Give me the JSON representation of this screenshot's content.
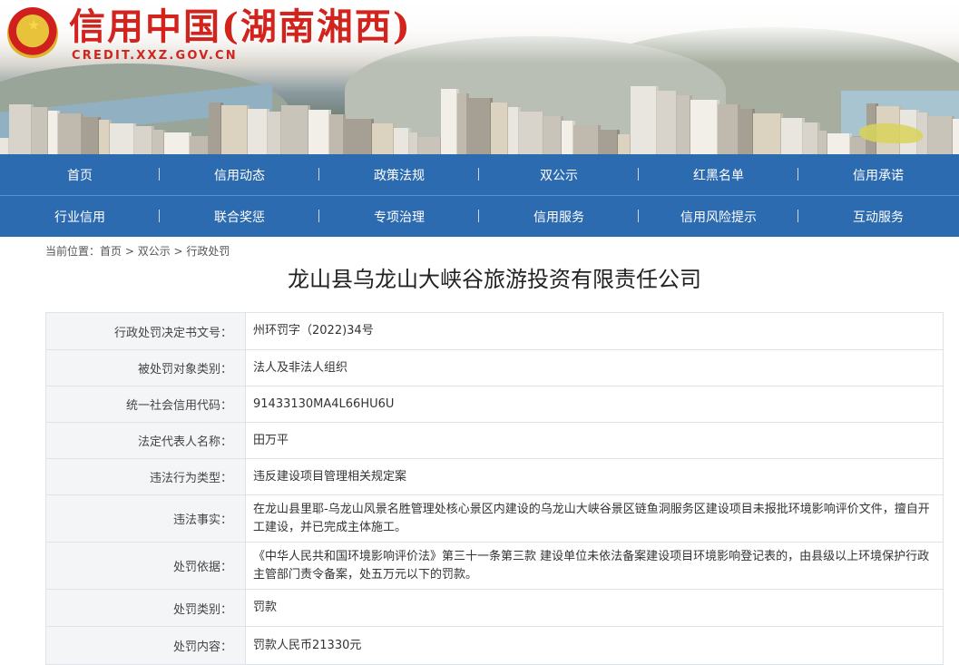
{
  "header": {
    "site_title": "信用中国(湖南湘西)",
    "site_url": "CREDIT.XXZ.GOV.CN"
  },
  "nav": {
    "row1": [
      "首页",
      "信用动态",
      "政策法规",
      "双公示",
      "红黑名单",
      "信用承诺"
    ],
    "row2": [
      "行业信用",
      "联合奖惩",
      "专项治理",
      "信用服务",
      "信用风险提示",
      "互动服务"
    ]
  },
  "breadcrumb": {
    "prefix": "当前位置：",
    "items": [
      "首页",
      "双公示",
      "行政处罚"
    ],
    "separator": " > "
  },
  "page_title": "龙山县乌龙山大峡谷旅游投资有限责任公司",
  "details": [
    {
      "label": "行政处罚决定书文号：",
      "value": "州环罚字（2022)34号"
    },
    {
      "label": "被处罚对象类别：",
      "value": "法人及非法人组织"
    },
    {
      "label": "统一社会信用代码：",
      "value": "91433130MA4L66HU6U"
    },
    {
      "label": "法定代表人名称：",
      "value": "田万平"
    },
    {
      "label": "违法行为类型：",
      "value": "违反建设项目管理相关规定案"
    },
    {
      "label": "违法事实：",
      "value": "在龙山县里耶-乌龙山风景名胜管理处核心景区内建设的乌龙山大峡谷景区链鱼洞服务区建设项目未报批环境影响评价文件，擅自开工建设，并已完成主体施工。"
    },
    {
      "label": "处罚依据：",
      "value": "《中华人民共和国环境影响评价法》第三十一条第三款 建设单位未依法备案建设项目环境影响登记表的，由县级以上环境保护行政主管部门责令备案，处五万元以下的罚款。"
    },
    {
      "label": "处罚类别：",
      "value": "罚款"
    },
    {
      "label": "处罚内容：",
      "value": "罚款人民币21330元"
    }
  ],
  "colors": {
    "nav_bg": "#2d6bb0",
    "title_red": "#d2231d"
  }
}
